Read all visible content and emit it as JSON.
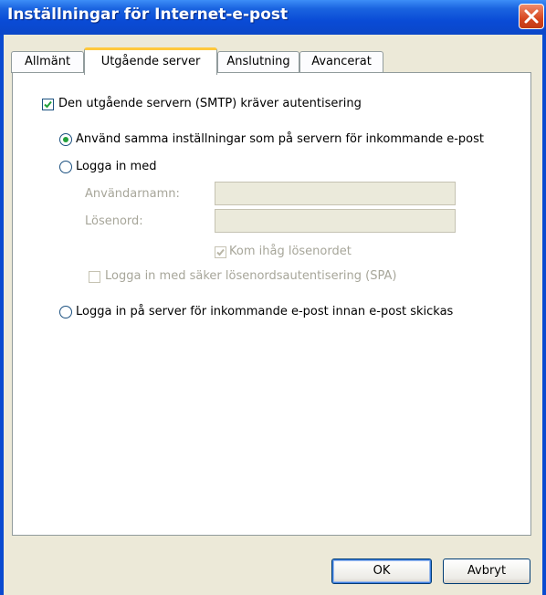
{
  "window": {
    "title": "Inställningar för Internet-e-post"
  },
  "tabs": [
    {
      "label": "Allmänt",
      "active": false
    },
    {
      "label": "Utgående server",
      "active": true
    },
    {
      "label": "Anslutning",
      "active": false
    },
    {
      "label": "Avancerat",
      "active": false
    }
  ],
  "smtp_auth": {
    "label": "Den utgående servern (SMTP) kräver autentisering",
    "checked": true
  },
  "options": {
    "same_settings": {
      "label": "Använd samma inställningar som på servern för inkommande e-post",
      "selected": true
    },
    "login_with": {
      "label": "Logga in med",
      "selected": false
    },
    "login_before_send": {
      "label": "Logga in på server för inkommande e-post innan e-post skickas",
      "selected": false
    }
  },
  "credentials": {
    "username_label": "Användarnamn:",
    "username_value": "",
    "password_label": "Lösenord:",
    "password_value": "",
    "remember_label": "Kom ihåg lösenordet",
    "remember_checked": true,
    "spa_label": "Logga in med säker lösenordsautentisering (SPA)",
    "spa_checked": false
  },
  "buttons": {
    "ok": "OK",
    "cancel": "Avbryt"
  },
  "colors": {
    "title_bar": "#0a4bd6",
    "accent_tab": "#ffc83c",
    "radio_dot": "#22a03a",
    "check": "#22a03a"
  }
}
